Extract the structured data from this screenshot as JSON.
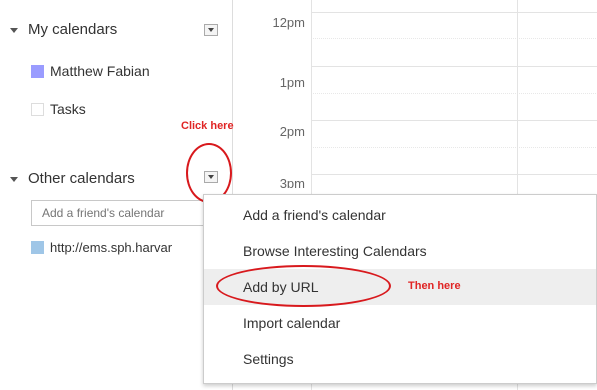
{
  "sidebar": {
    "my_calendars": {
      "title": "My calendars",
      "items": [
        {
          "label": "Matthew Fabian",
          "color": "#9a9cff"
        },
        {
          "label": "Tasks",
          "color": "#ffffff"
        }
      ]
    },
    "other_calendars": {
      "title": "Other calendars",
      "input_placeholder": "Add a friend's calendar",
      "items": [
        {
          "label": "http://ems.sph.harvar",
          "color": "#9fc6e7"
        }
      ]
    }
  },
  "grid": {
    "times": [
      "12pm",
      "1pm",
      "2pm",
      "3pm"
    ]
  },
  "menu": {
    "items": [
      {
        "label": "Add a friend's calendar"
      },
      {
        "label": "Browse Interesting Calendars"
      },
      {
        "label": "Add by URL"
      },
      {
        "label": "Import calendar"
      },
      {
        "label": "Settings"
      }
    ]
  },
  "annotations": {
    "click_here": "Click here",
    "then_here": "Then here",
    "color": "#e02424"
  }
}
